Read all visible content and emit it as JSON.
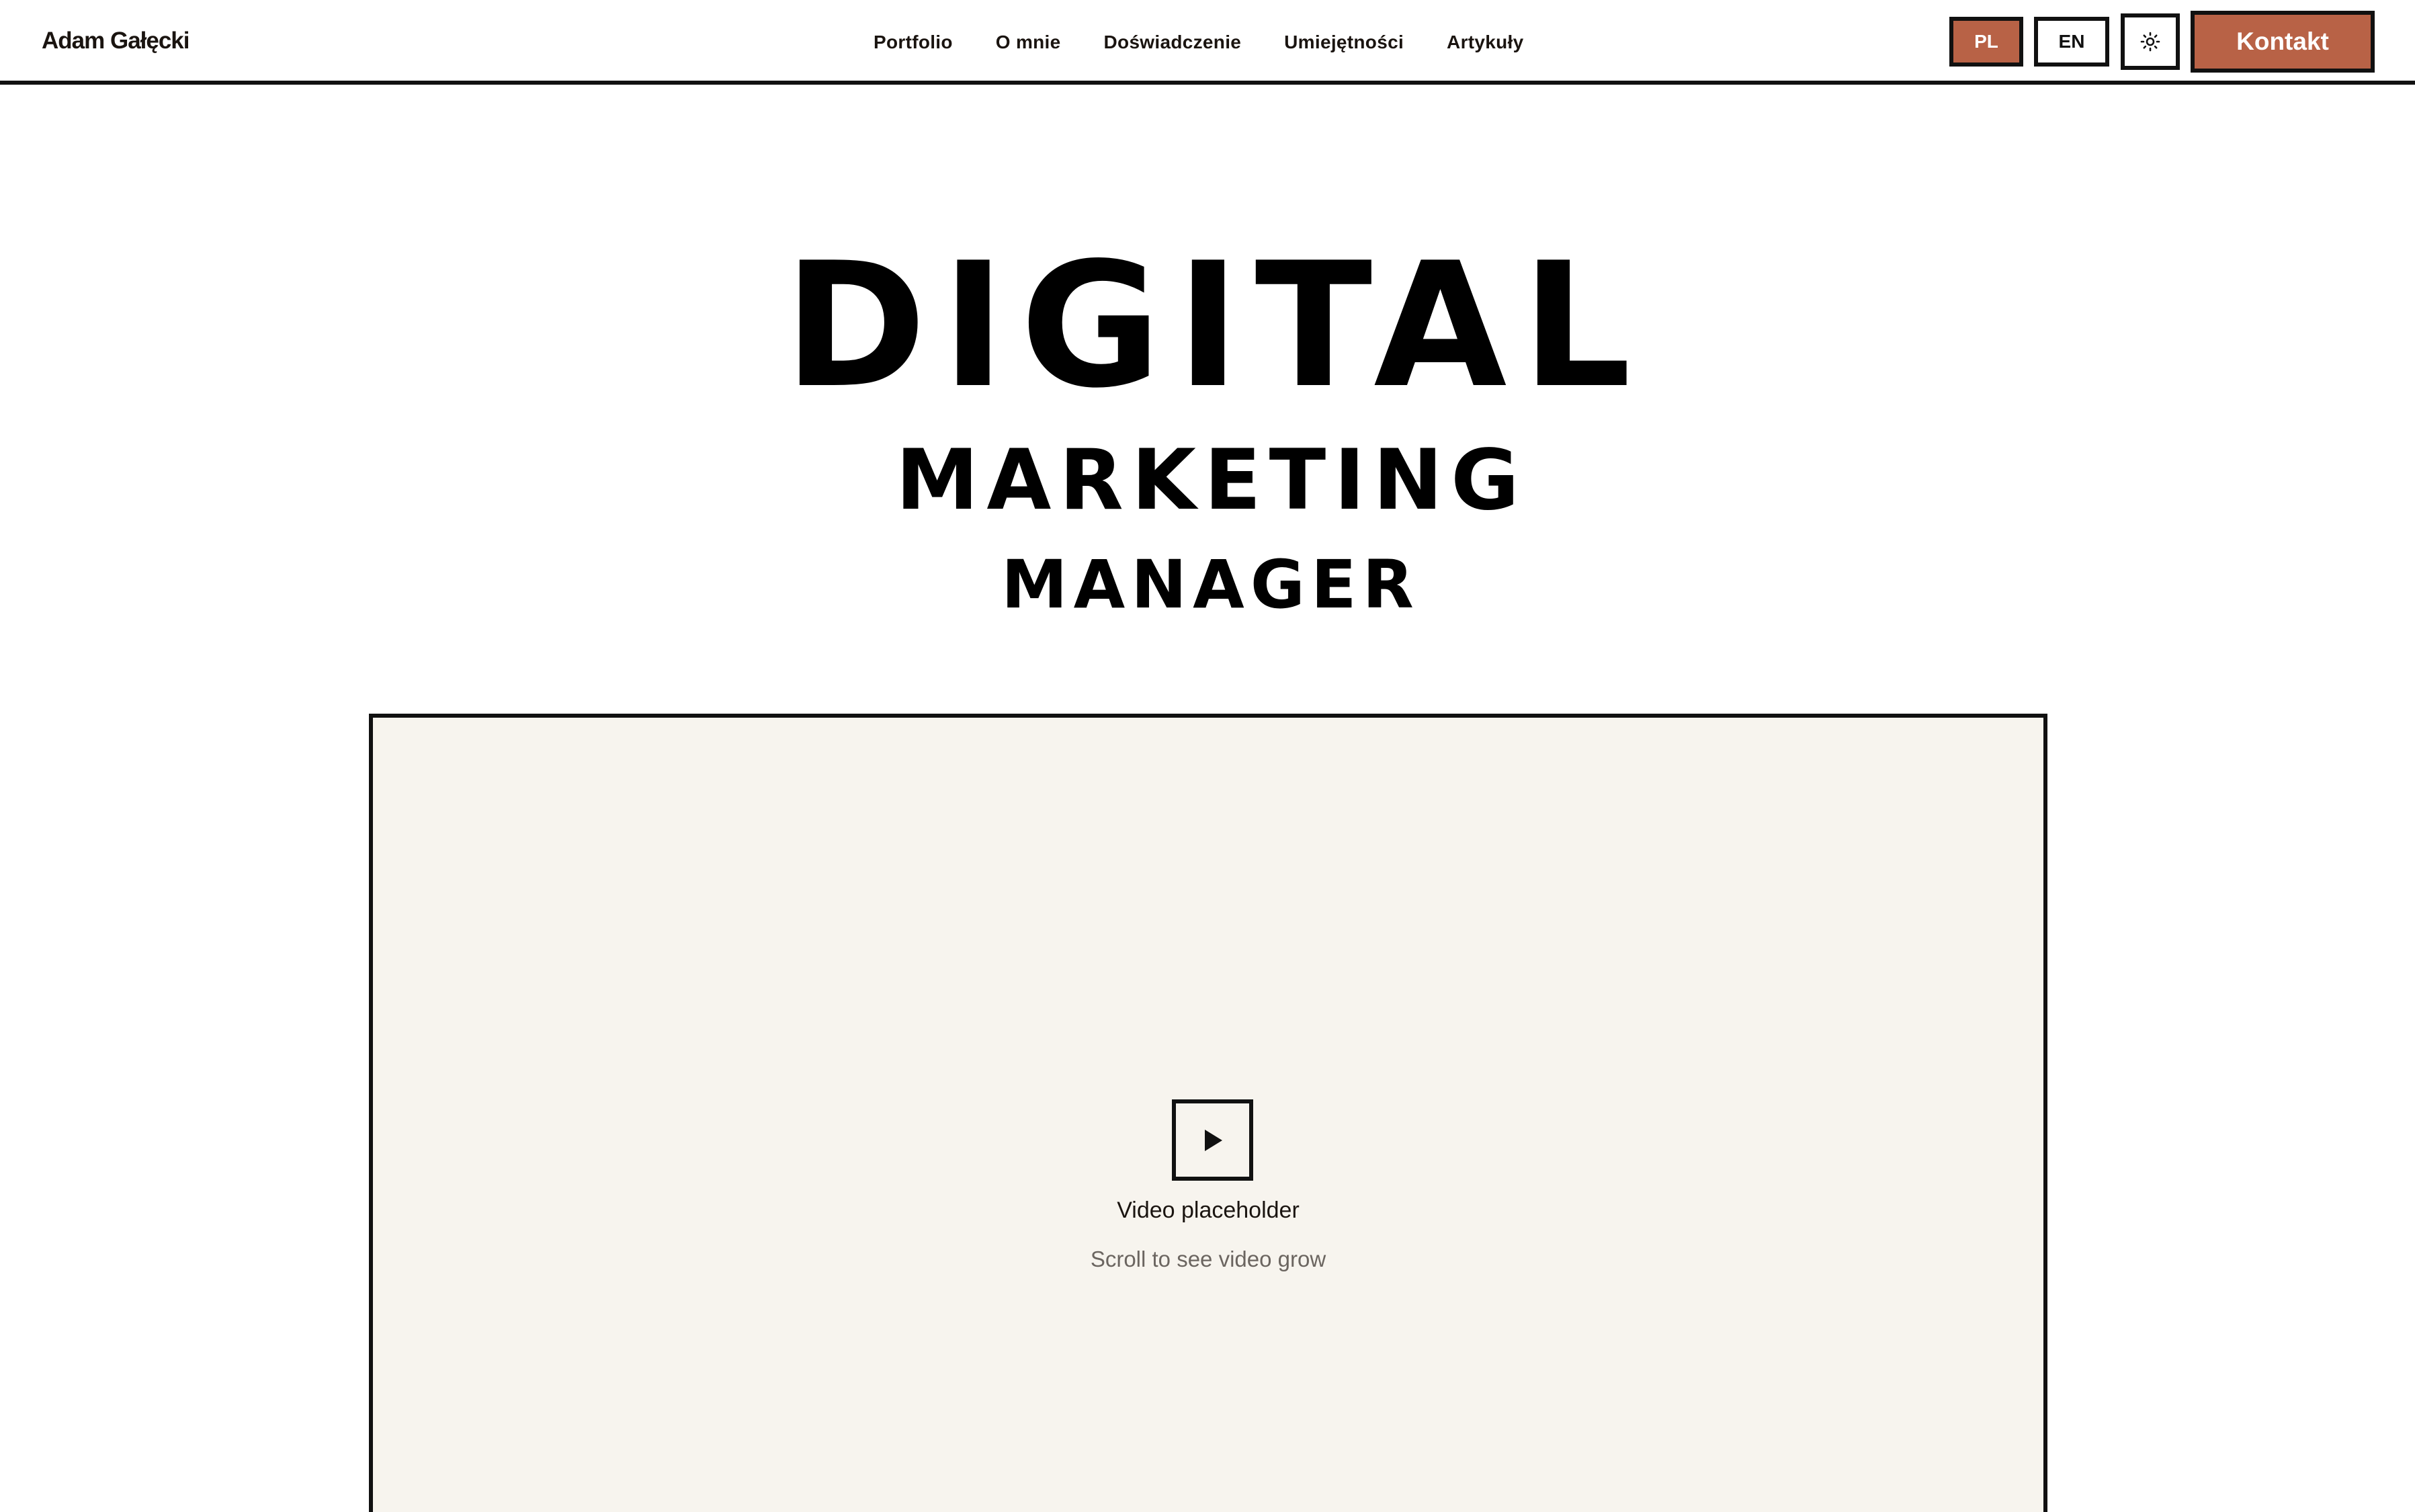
{
  "header": {
    "brand": "Adam Gałęcki",
    "nav": [
      {
        "label": "Portfolio"
      },
      {
        "label": "O mnie"
      },
      {
        "label": "Doświadczenie"
      },
      {
        "label": "Umiejętności"
      },
      {
        "label": "Artykuły"
      }
    ],
    "lang_pl": "PL",
    "lang_en": "EN",
    "theme_icon": "sun-icon",
    "contact_label": "Kontakt"
  },
  "hero": {
    "line1": "DIGITAL",
    "line2": "MARKETING",
    "line3": "MANAGER"
  },
  "video": {
    "icon": "play-icon",
    "title": "Video placeholder",
    "subtitle": "Scroll to see video grow"
  },
  "colors": {
    "accent": "#b86246",
    "border": "#111111",
    "video_bg": "#f7f4ee",
    "muted_text": "#6b6560"
  }
}
